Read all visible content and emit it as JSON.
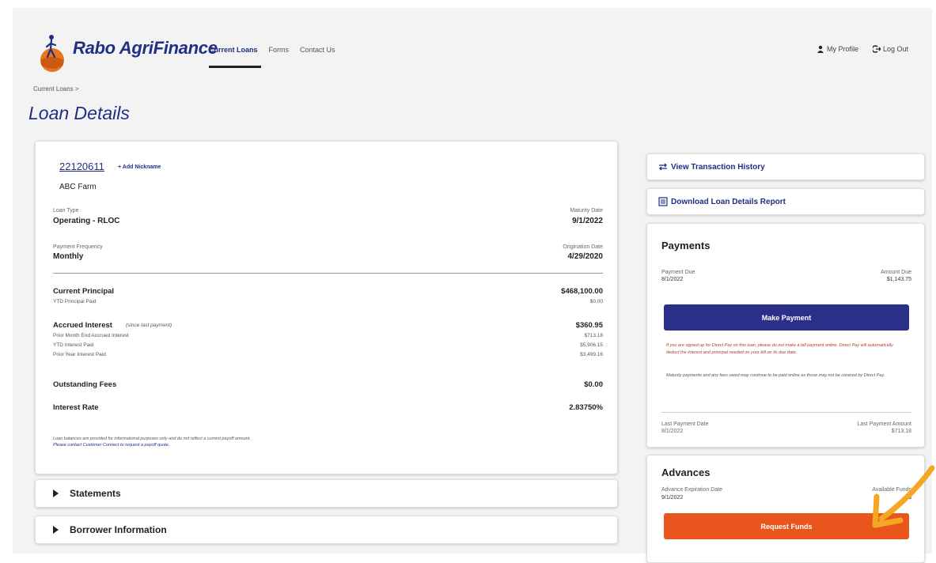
{
  "brand": {
    "name": "Rabo AgriFinance"
  },
  "nav": {
    "items": [
      {
        "label": "Current Loans",
        "active": true
      },
      {
        "label": "Forms",
        "active": false
      },
      {
        "label": "Contact Us",
        "active": false
      }
    ]
  },
  "top_right": {
    "profile_label": "My Profile",
    "logout_label": "Log Out"
  },
  "breadcrumb": "Current Loans >",
  "page_title": "Loan Details",
  "loan": {
    "number": "22120611",
    "nickname_link": "+ Add Nickname",
    "borrower": "ABC Farm",
    "loan_type_label": "Loan Type",
    "loan_type": "Operating - RLOC",
    "maturity_label": "Maturity Date",
    "maturity_date": "9/1/2022",
    "payment_freq_label": "Payment Frequency",
    "payment_freq": "Monthly",
    "origination_label": "Origination Date",
    "origination_date": "4/29/2020"
  },
  "balances": {
    "current_principal_label": "Current Principal",
    "current_principal": "$468,100.00",
    "ytd_principal_label": "YTD Principal Paid",
    "ytd_principal": "$0.00",
    "accrued_interest_label": "Accrued Interest",
    "accrued_interest_note": "(since last payment)",
    "accrued_interest": "$360.95",
    "prior_month_label": "Prior Month End Accrued Interest",
    "prior_month": "$713.18",
    "ytd_interest_label": "YTD Interest Paid",
    "ytd_interest": "$5,906.15",
    "prior_year_label": "Prior Year Interest Paid",
    "prior_year": "$3,499.16",
    "outstanding_fees_label": "Outstanding Fees",
    "outstanding_fees": "$0.00",
    "interest_rate_label": "Interest Rate",
    "interest_rate": "2.83750%",
    "disclaimer_1": "Loan balances are provided for informational purposes only and do not reflect a current payoff amount.",
    "disclaimer_2": "Please contact Customer Connect to request a payoff quote."
  },
  "accordions": {
    "statements": "Statements",
    "borrower_info": "Borrower Information"
  },
  "actions": {
    "view_history": "View Transaction History",
    "download_report": "Download Loan Details Report"
  },
  "payments": {
    "title": "Payments",
    "payment_due_label": "Payment Due",
    "payment_due": "8/1/2022",
    "amount_due_label": "Amount Due",
    "amount_due": "$1,143.75",
    "make_payment": "Make Payment",
    "notice_1": "If you are signed up for Direct Pay on this loan, please do not make a bill payment online. Direct Pay will automatically deduct the interest and principal needed on your bill on its due date.",
    "notice_2": "Maturity payments and any fees owed may continue to be paid online as those may not be covered by Direct Pay.",
    "last_payment_date_label": "Last Payment Date",
    "last_payment_date": "8/1/2022",
    "last_payment_amount_label": "Last Payment Amount",
    "last_payment_amount": "$713.18"
  },
  "advances": {
    "title": "Advances",
    "expiration_label": "Advance Expiration Date",
    "expiration_date": "9/1/2022",
    "available_label": "Available Funds",
    "available": "$",
    "request_funds": "Request Funds"
  },
  "colors": {
    "brand_navy": "#1e2f85",
    "button_navy": "#2a2f8a",
    "accent_orange": "#e8561e",
    "pointer_orange": "#f5a623"
  }
}
